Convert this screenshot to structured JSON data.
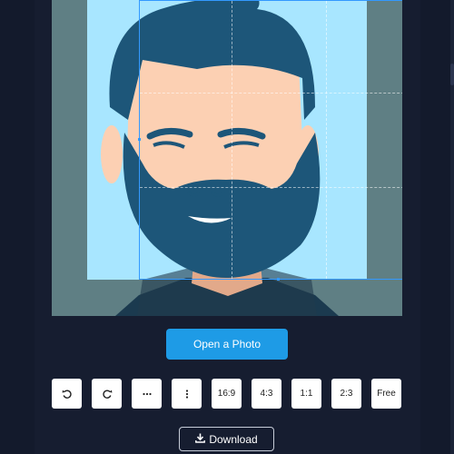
{
  "actions": {
    "open_photo_label": "Open a Photo",
    "download_label": "Download"
  },
  "toolbar": {
    "ratio_16_9": "16:9",
    "ratio_4_3": "4:3",
    "ratio_1_1": "1:1",
    "ratio_2_3": "2:3",
    "ratio_free": "Free"
  },
  "icons": {
    "rotate_left": "rotate-left-icon",
    "rotate_right": "rotate-right-icon",
    "flip_horizontal": "flip-horizontal-icon",
    "flip_vertical": "flip-vertical-icon",
    "download": "download-icon"
  },
  "colors": {
    "background": "#131a2c",
    "accent": "#1e9be6",
    "crop_border": "#3399ff",
    "photo_sky": "#a8e6ff",
    "hair": "#1d5679",
    "skin": "#fcd0b3"
  }
}
